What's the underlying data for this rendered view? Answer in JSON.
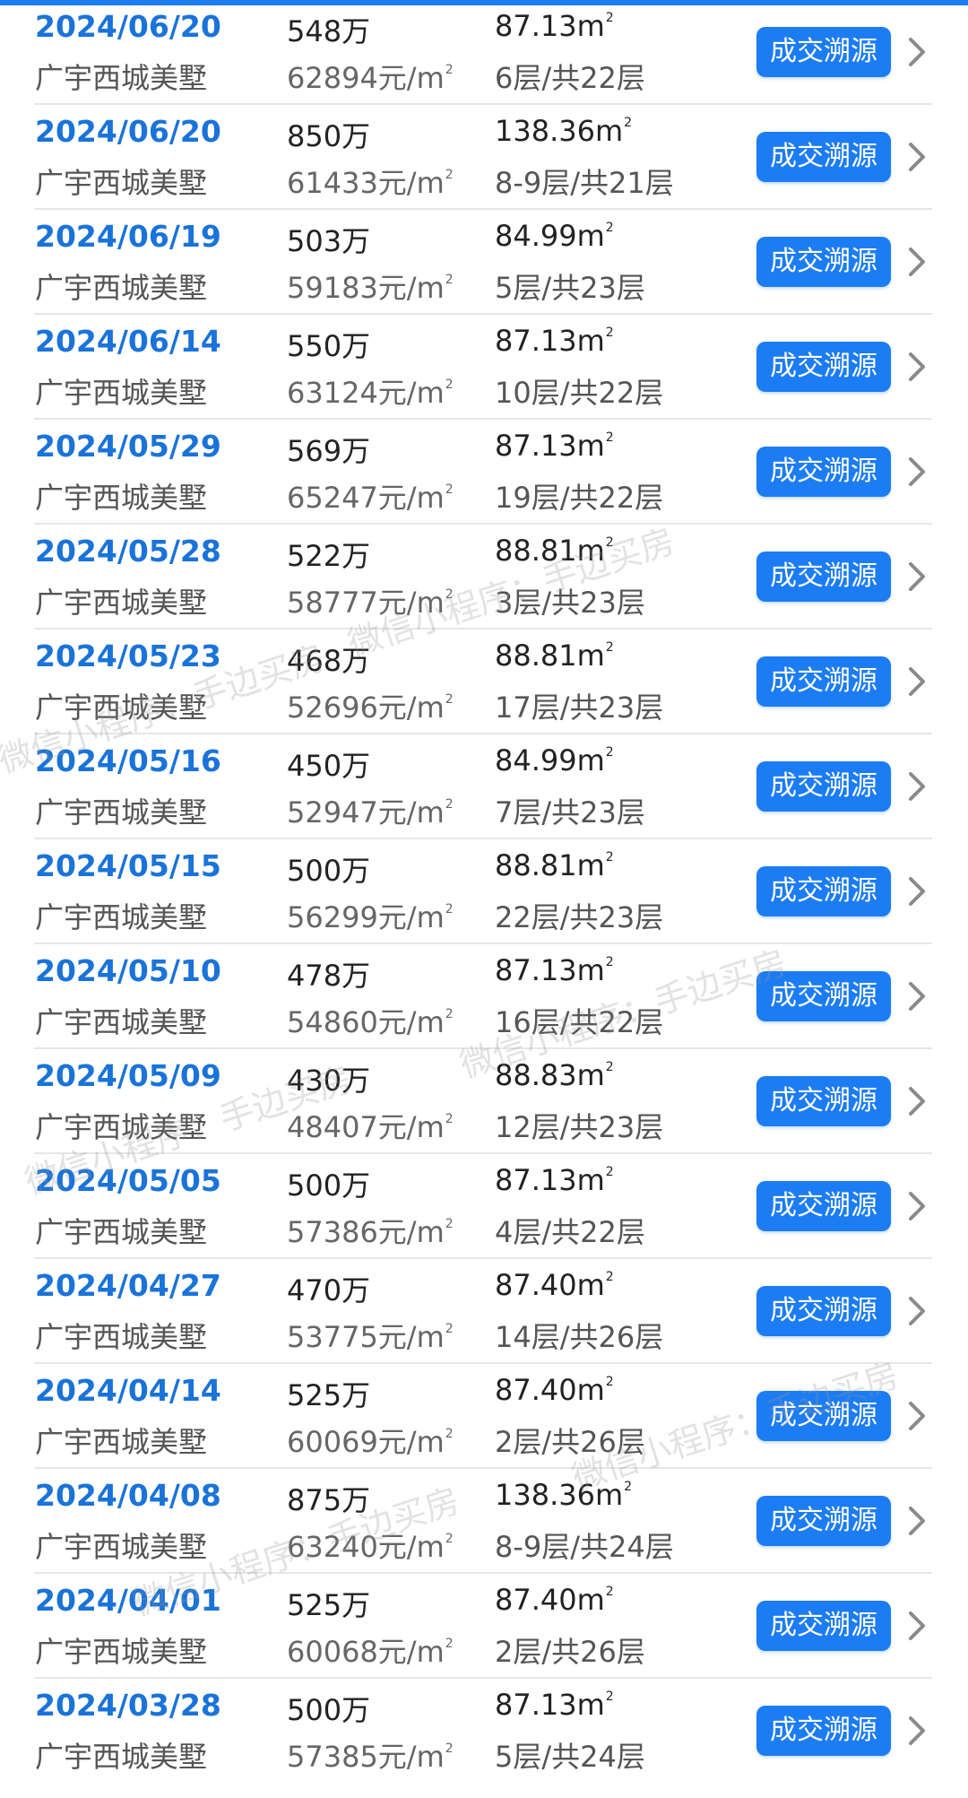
{
  "trace_button_label": "成交溯源",
  "area_unit": "m",
  "unit_price_suffix": "元/m",
  "watermark_text": "微信小程序：手边买房",
  "accent_color": "#1c7cf3",
  "date_color": "#1a73d9",
  "transactions": [
    {
      "date": "2024/06/20",
      "community": "广宇西城美墅",
      "total_price": "548万",
      "unit_price": "62894",
      "area": "87.13",
      "floor": "6层/共22层"
    },
    {
      "date": "2024/06/20",
      "community": "广宇西城美墅",
      "total_price": "850万",
      "unit_price": "61433",
      "area": "138.36",
      "floor": "8-9层/共21层"
    },
    {
      "date": "2024/06/19",
      "community": "广宇西城美墅",
      "total_price": "503万",
      "unit_price": "59183",
      "area": "84.99",
      "floor": "5层/共23层"
    },
    {
      "date": "2024/06/14",
      "community": "广宇西城美墅",
      "total_price": "550万",
      "unit_price": "63124",
      "area": "87.13",
      "floor": "10层/共22层"
    },
    {
      "date": "2024/05/29",
      "community": "广宇西城美墅",
      "total_price": "569万",
      "unit_price": "65247",
      "area": "87.13",
      "floor": "19层/共22层"
    },
    {
      "date": "2024/05/28",
      "community": "广宇西城美墅",
      "total_price": "522万",
      "unit_price": "58777",
      "area": "88.81",
      "floor": "3层/共23层"
    },
    {
      "date": "2024/05/23",
      "community": "广宇西城美墅",
      "total_price": "468万",
      "unit_price": "52696",
      "area": "88.81",
      "floor": "17层/共23层"
    },
    {
      "date": "2024/05/16",
      "community": "广宇西城美墅",
      "total_price": "450万",
      "unit_price": "52947",
      "area": "84.99",
      "floor": "7层/共23层"
    },
    {
      "date": "2024/05/15",
      "community": "广宇西城美墅",
      "total_price": "500万",
      "unit_price": "56299",
      "area": "88.81",
      "floor": "22层/共23层"
    },
    {
      "date": "2024/05/10",
      "community": "广宇西城美墅",
      "total_price": "478万",
      "unit_price": "54860",
      "area": "87.13",
      "floor": "16层/共22层"
    },
    {
      "date": "2024/05/09",
      "community": "广宇西城美墅",
      "total_price": "430万",
      "unit_price": "48407",
      "area": "88.83",
      "floor": "12层/共23层"
    },
    {
      "date": "2024/05/05",
      "community": "广宇西城美墅",
      "total_price": "500万",
      "unit_price": "57386",
      "area": "87.13",
      "floor": "4层/共22层"
    },
    {
      "date": "2024/04/27",
      "community": "广宇西城美墅",
      "total_price": "470万",
      "unit_price": "53775",
      "area": "87.40",
      "floor": "14层/共26层"
    },
    {
      "date": "2024/04/14",
      "community": "广宇西城美墅",
      "total_price": "525万",
      "unit_price": "60069",
      "area": "87.40",
      "floor": "2层/共26层"
    },
    {
      "date": "2024/04/08",
      "community": "广宇西城美墅",
      "total_price": "875万",
      "unit_price": "63240",
      "area": "138.36",
      "floor": "8-9层/共24层"
    },
    {
      "date": "2024/04/01",
      "community": "广宇西城美墅",
      "total_price": "525万",
      "unit_price": "60068",
      "area": "87.40",
      "floor": "2层/共26层"
    },
    {
      "date": "2024/03/28",
      "community": "广宇西城美墅",
      "total_price": "500万",
      "unit_price": "57385",
      "area": "87.13",
      "floor": "5层/共24层"
    }
  ]
}
